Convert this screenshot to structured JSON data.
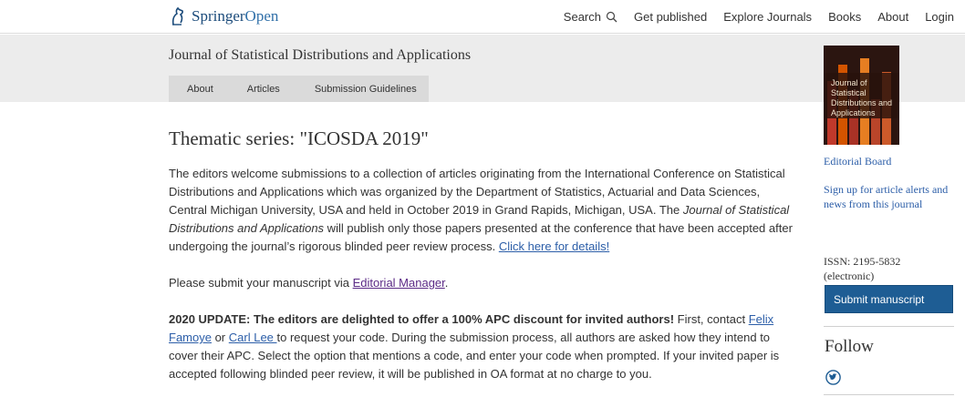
{
  "header": {
    "logo_brand": "Springer",
    "logo_suffix": "Open",
    "nav": {
      "search": "Search",
      "get_published": "Get published",
      "explore_journals": "Explore Journals",
      "books": "Books",
      "about": "About",
      "login": "Login"
    },
    "search_icon": "search-icon"
  },
  "journal": {
    "title": "Journal of Statistical Distributions and Applications",
    "subnav": [
      "About",
      "Articles",
      "Submission Guidelines"
    ]
  },
  "main": {
    "title": "Thematic series: \"ICOSDA 2019\"",
    "p1_text": "The editors welcome submissions to a collection of articles originating from the International Conference on Statistical Distributions and Applications which was organized by the Department of Statistics, Actuarial and Data Sciences, Central Michigan University, USA and held in October 2019 in Grand Rapids, Michigan, USA. The ",
    "p1_italic": "Journal of Statistical Distributions and Applications",
    "p1_text2": " will publish only those papers presented at the conference that have been accepted after undergoing the journal’s rigorous blinded peer review process. ",
    "p1_link": "Click here for details!",
    "p2_text": "Please submit your manuscript via ",
    "p2_link": "Editorial Manager",
    "p2_end": ".",
    "p3_bold": "2020 UPDATE: The editors are delighted to offer a 100% APC discount for invited authors!",
    "p3_text1": " First, contact ",
    "p3_link1": "Felix Famoye",
    "p3_text2": " or ",
    "p3_link2": "Carl Lee ",
    "p3_text3": "to request your code. During the submission process, all authors are asked how they intend to cover their APC. Select the option that mentions a code, and enter your code when prompted. If your invited paper is accepted following blinded peer review, it will be published in OA format at no charge to you."
  },
  "sidebar": {
    "cover_title": "Journal of Statistical Distributions and Applications",
    "editorial_board": "Editorial Board",
    "alerts_link": "Sign up for article alerts and news from this journal",
    "issn": "ISSN: 2195-5832 (electronic)",
    "submit_button": "Submit manuscript",
    "follow_title": "Follow",
    "twitter_icon": "twitter-icon"
  },
  "colors": {
    "link": "#2c5ea8",
    "visited_link": "#5b2a86",
    "button": "#1e5d94",
    "band": "#ececec"
  }
}
